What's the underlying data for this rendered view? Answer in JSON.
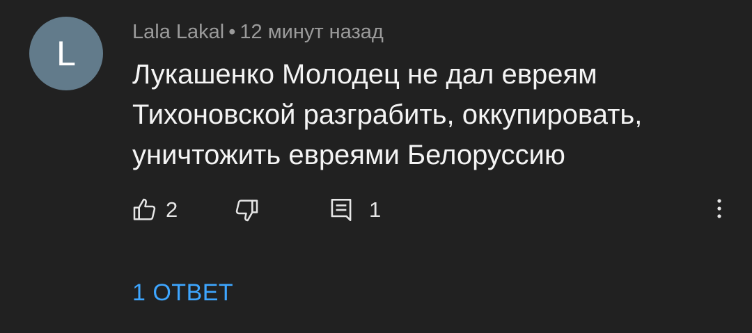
{
  "comment": {
    "avatar_letter": "L",
    "author": "Lala Lakal",
    "separator": "•",
    "time": "12 минут назад",
    "text": "Лукашенко Молодец не дал евреям Тихоновской разграбить, оккупировать, уничтожить евреями Белоруссию",
    "like_count": "2",
    "reply_count": "1",
    "icons": {
      "like": "thumbs-up-icon",
      "dislike": "thumbs-down-icon",
      "reply": "comment-icon",
      "more": "more-vert-icon"
    }
  },
  "replies": {
    "label": "1 ОТВЕТ"
  },
  "colors": {
    "background": "#212121",
    "avatar": "#627b8b",
    "link": "#3ea6ff"
  }
}
